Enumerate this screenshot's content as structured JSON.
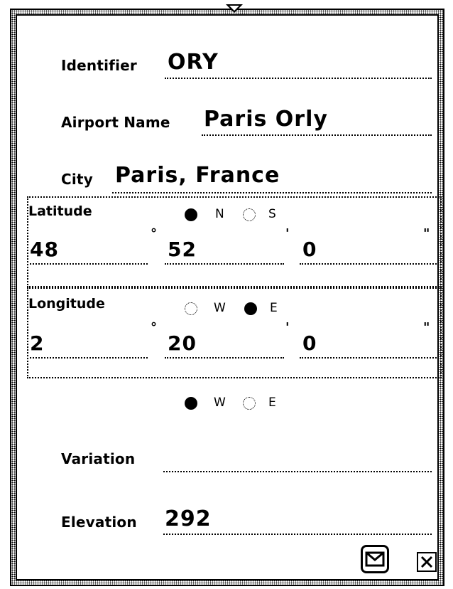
{
  "form": {
    "identifier": {
      "label": "Identifier",
      "value": "ORY"
    },
    "airport_name": {
      "label": "Airport Name",
      "value": "Paris Orly"
    },
    "city": {
      "label": "City",
      "value": "Paris, France"
    },
    "latitude": {
      "label": "Latitude",
      "hemisphere_options": [
        "N",
        "S"
      ],
      "hemisphere_selected": "N",
      "degrees": "48",
      "minutes": "52",
      "seconds": "0",
      "deg_symbol": "°",
      "min_symbol": "'",
      "sec_symbol": "\""
    },
    "longitude": {
      "label": "Longitude",
      "hemisphere_options": [
        "W",
        "E"
      ],
      "hemisphere_selected": "E",
      "degrees": "2",
      "minutes": "20",
      "seconds": "0",
      "deg_symbol": "°",
      "min_symbol": "'",
      "sec_symbol": "\""
    },
    "variation": {
      "label": "Variation",
      "direction_options": [
        "W",
        "E"
      ],
      "direction_selected": "W",
      "value": ""
    },
    "elevation": {
      "label": "Elevation",
      "value": "292"
    }
  },
  "icons": {
    "send": "envelope-icon",
    "close": "close-icon"
  }
}
